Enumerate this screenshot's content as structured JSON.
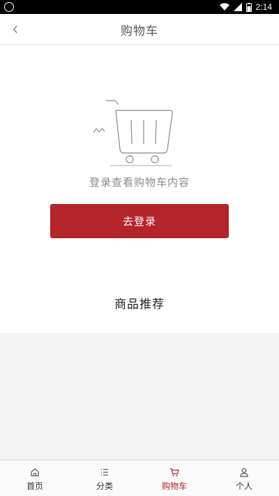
{
  "status_bar": {
    "time": "2:14"
  },
  "header": {
    "title": "购物车"
  },
  "empty_state": {
    "message": "登录查看购物车内容",
    "button_label": "去登录"
  },
  "recommend": {
    "title": "商品推荐"
  },
  "tabbar": {
    "items": [
      {
        "label": "首页",
        "icon": "home-icon",
        "active": false
      },
      {
        "label": "分类",
        "icon": "list-icon",
        "active": false
      },
      {
        "label": "购物车",
        "icon": "cart-icon",
        "active": true
      },
      {
        "label": "个人",
        "icon": "user-icon",
        "active": false
      }
    ]
  },
  "colors": {
    "accent": "#b5232b",
    "tab_active": "#b5232b",
    "background_gray": "#f3f3f3"
  }
}
